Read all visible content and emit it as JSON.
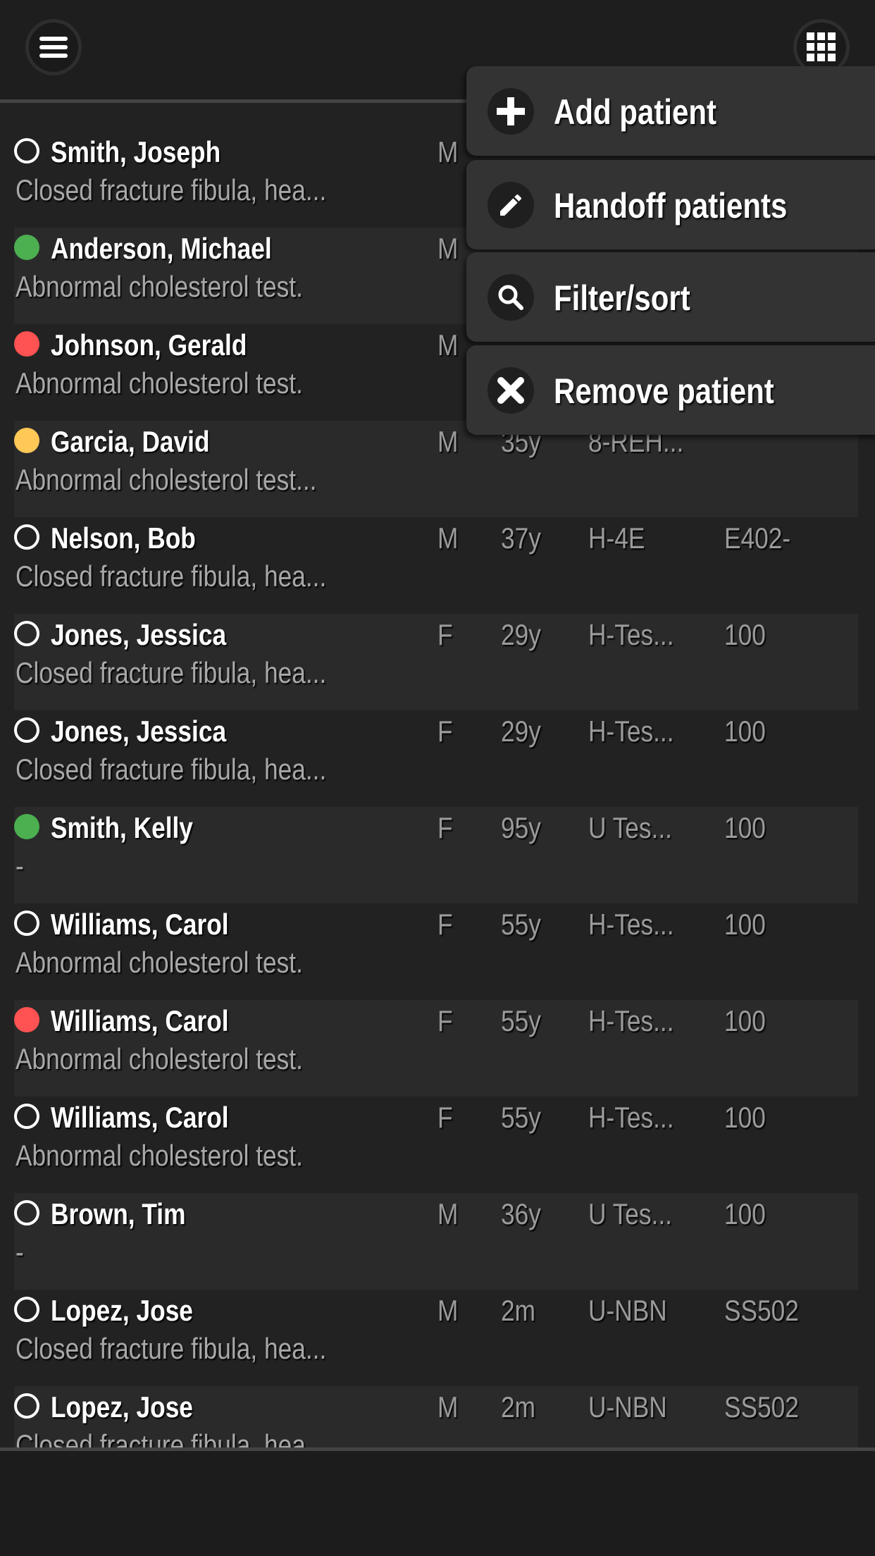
{
  "topbar": {
    "menu_icon": "hamburger-menu-icon",
    "apps_icon": "grid-apps-icon"
  },
  "menu": [
    {
      "label": "Add patient",
      "icon": "plus-icon"
    },
    {
      "label": "Handoff patients",
      "icon": "pencil-icon"
    },
    {
      "label": "Filter/sort",
      "icon": "search-icon"
    },
    {
      "label": "Remove patient",
      "icon": "close-icon"
    }
  ],
  "status_colors": {
    "none": "#ffffff",
    "green": "#4caf50",
    "red": "#ff5252",
    "yellow": "#ffc857"
  },
  "patients": [
    {
      "name": "Smith, Joseph",
      "status": "none",
      "sex": "M",
      "age": "",
      "location": "",
      "room": "",
      "diagnosis": "Closed fracture fibula, hea..."
    },
    {
      "name": "Anderson, Michael",
      "status": "green",
      "sex": "M",
      "age": "",
      "location": "",
      "room": "",
      "diagnosis": "Abnormal cholesterol test."
    },
    {
      "name": "Johnson, Gerald",
      "status": "red",
      "sex": "M",
      "age": "",
      "location": "",
      "room": "",
      "diagnosis": "Abnormal cholesterol test."
    },
    {
      "name": "Garcia, David",
      "status": "yellow",
      "sex": "M",
      "age": "35y",
      "location": "8-REH...",
      "room": "",
      "diagnosis": "Abnormal cholesterol test..."
    },
    {
      "name": "Nelson, Bob",
      "status": "none",
      "sex": "M",
      "age": "37y",
      "location": "H-4E",
      "room": "E402-",
      "diagnosis": "Closed fracture fibula, hea..."
    },
    {
      "name": "Jones, Jessica",
      "status": "none",
      "sex": "F",
      "age": "29y",
      "location": "H-Tes...",
      "room": "100",
      "diagnosis": "Closed fracture fibula, hea..."
    },
    {
      "name": "Jones, Jessica",
      "status": "none",
      "sex": "F",
      "age": "29y",
      "location": "H-Tes...",
      "room": "100",
      "diagnosis": "Closed fracture fibula, hea..."
    },
    {
      "name": "Smith, Kelly",
      "status": "green",
      "sex": "F",
      "age": "95y",
      "location": "U Tes...",
      "room": "100",
      "diagnosis": "-"
    },
    {
      "name": "Williams, Carol",
      "status": "none",
      "sex": "F",
      "age": "55y",
      "location": "H-Tes...",
      "room": "100",
      "diagnosis": "Abnormal cholesterol test."
    },
    {
      "name": "Williams, Carol",
      "status": "red",
      "sex": "F",
      "age": "55y",
      "location": "H-Tes...",
      "room": "100",
      "diagnosis": "Abnormal cholesterol test."
    },
    {
      "name": "Williams, Carol",
      "status": "none",
      "sex": "F",
      "age": "55y",
      "location": "H-Tes...",
      "room": "100",
      "diagnosis": "Abnormal cholesterol test."
    },
    {
      "name": "Brown, Tim",
      "status": "none",
      "sex": "M",
      "age": "36y",
      "location": "U Tes...",
      "room": "100",
      "diagnosis": "-"
    },
    {
      "name": "Lopez, Jose",
      "status": "none",
      "sex": "M",
      "age": "2m",
      "location": "U-NBN",
      "room": "SS502",
      "diagnosis": "Closed fracture fibula, hea..."
    },
    {
      "name": "Lopez, Jose",
      "status": "none",
      "sex": "M",
      "age": "2m",
      "location": "U-NBN",
      "room": "SS502",
      "diagnosis": "Closed fracture fibula, hea..."
    }
  ]
}
